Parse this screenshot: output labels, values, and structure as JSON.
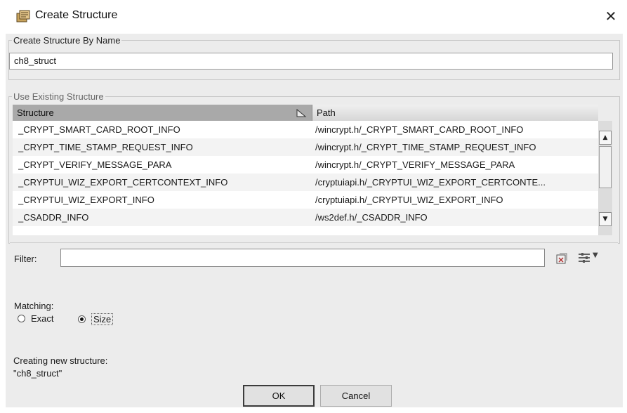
{
  "window": {
    "title": "Create Structure",
    "close_glyph": "✕"
  },
  "by_name": {
    "legend": "Create Structure By Name",
    "value": "ch8_struct"
  },
  "existing": {
    "legend": "Use Existing Structure",
    "columns": [
      "Structure",
      "Path"
    ],
    "rows": [
      {
        "structure": "_CRYPT_SMART_CARD_ROOT_INFO",
        "path": "/wincrypt.h/_CRYPT_SMART_CARD_ROOT_INFO"
      },
      {
        "structure": "_CRYPT_TIME_STAMP_REQUEST_INFO",
        "path": "/wincrypt.h/_CRYPT_TIME_STAMP_REQUEST_INFO"
      },
      {
        "structure": "_CRYPT_VERIFY_MESSAGE_PARA",
        "path": "/wincrypt.h/_CRYPT_VERIFY_MESSAGE_PARA"
      },
      {
        "structure": "_CRYPTUI_WIZ_EXPORT_CERTCONTEXT_INFO",
        "path": "/cryptuiapi.h/_CRYPTUI_WIZ_EXPORT_CERTCONTE..."
      },
      {
        "structure": "_CRYPTUI_WIZ_EXPORT_INFO",
        "path": "/cryptuiapi.h/_CRYPTUI_WIZ_EXPORT_INFO"
      },
      {
        "structure": "_CSADDR_INFO",
        "path": "/ws2def.h/_CSADDR_INFO"
      }
    ]
  },
  "filter": {
    "label": "Filter:",
    "value": ""
  },
  "matching": {
    "label": "Matching:",
    "options": [
      "Exact",
      "Size"
    ],
    "selected": "Size"
  },
  "status": {
    "line1": "Creating new structure:",
    "line2": "\"ch8_struct\""
  },
  "buttons": {
    "ok": "OK",
    "cancel": "Cancel"
  },
  "icons": {
    "app": "structure-icon",
    "sort": "sort-icon",
    "clear": "clear-filter-icon",
    "options": "filter-options-icon"
  }
}
